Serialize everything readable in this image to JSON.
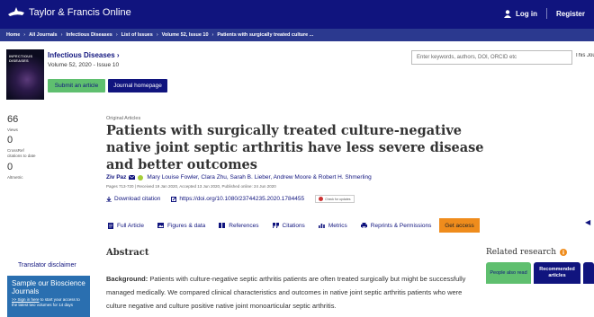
{
  "header": {
    "logo_text": "Taylor & Francis Online",
    "login": "Log in",
    "register": "Register"
  },
  "breadcrumb": [
    "Home",
    "All Journals",
    "Infectious Diseases",
    "List of Issues",
    "Volume 52, Issue 10",
    "Patients with surgically treated culture ..."
  ],
  "journal": {
    "cover_text": "INFECTIOUS DISEASES",
    "title": "Infectious Diseases ›",
    "volume": "Volume 52, 2020 - Issue 10",
    "submit_label": "Submit an article",
    "homepage_label": "Journal homepage"
  },
  "search": {
    "placeholder": "Enter keywords, authors, DOI, ORCID etc",
    "scope_clipped": "This Journal"
  },
  "metrics": [
    {
      "value": "66",
      "label": "Views"
    },
    {
      "value": "0",
      "label": "CrossRef citations to date"
    },
    {
      "value": "0",
      "label": "Altmetric"
    }
  ],
  "article": {
    "type": "Original Articles",
    "title": "Patients with surgically treated culture-negative native joint septic arthritis have less severe disease and better outcomes",
    "lead_author": "Ziv Paz",
    "other_authors": "Mary Louise Fowler, Clara Zhu, Sarah B. Lieber, Andrew Moore & Robert H. Shmerling",
    "dates": "Pages 713-720 | Received 19 Jan 2020, Accepted 13 Jun 2020, Published online: 24 Jun 2020",
    "download_citation": "Download citation",
    "doi": "https://doi.org/10.1080/23744235.2020.1784455",
    "check_updates": "Check for updates"
  },
  "tabs": [
    {
      "label": "Full Article",
      "icon": "document-icon"
    },
    {
      "label": "Figures & data",
      "icon": "image-icon"
    },
    {
      "label": "References",
      "icon": "book-icon"
    },
    {
      "label": "Citations",
      "icon": "quote-icon"
    },
    {
      "label": "Metrics",
      "icon": "bar-chart-icon"
    },
    {
      "label": "Reprints & Permissions",
      "icon": "print-icon"
    }
  ],
  "get_access": "Get access",
  "abstract": {
    "heading": "Abstract",
    "background_label": "Background:",
    "background_text": "Patients with culture-negative septic arthritis patients are often treated surgically but might be successfully managed medically. We compared clinical characteristics and outcomes in native joint septic arthritis patients who were culture negative and culture positive native joint monoarticular septic arthritis."
  },
  "sidebar": {
    "translator": "Translator disclaimer",
    "promo_title": "Sample our Bioscience Journals",
    "promo_text_pre": "",
    "promo_link": ">> Sign in here",
    "promo_text_post": "to start your access to the latest two volumes for 14 days"
  },
  "related": {
    "heading": "Related research",
    "tab1": "People also read",
    "tab2": "Recommended articles"
  },
  "colors": {
    "navy": "#10147e",
    "crumb": "#2b398f",
    "green": "#5fbf6f",
    "orange": "#ef8c1c",
    "promo": "#2a6fb0"
  }
}
